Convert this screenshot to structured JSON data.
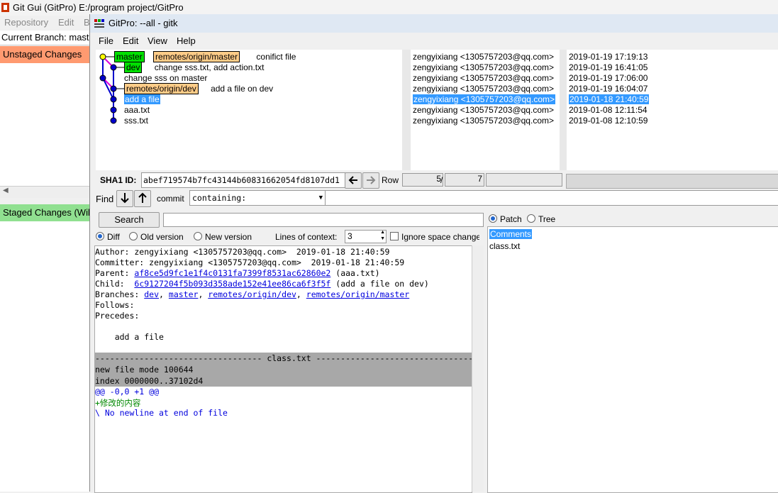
{
  "gitgui": {
    "title": "Git Gui (GitPro) E:/program project/GitPro",
    "menu": [
      "Repository",
      "Edit",
      "B"
    ],
    "current_branch": "Current Branch: master",
    "unstaged_header": "Unstaged Changes",
    "staged_header": "Staged Changes (Will Commit)"
  },
  "gitk": {
    "title": "GitPro: --all - gitk",
    "menu": [
      "File",
      "Edit",
      "View",
      "Help"
    ],
    "commits": [
      {
        "refs": [
          {
            "text": "master",
            "style": "green"
          },
          {
            "text": "remotes/origin/master",
            "style": "orange"
          }
        ],
        "msg": "conifict file",
        "author": "zengyixiang <1305757203@qq.com>",
        "date": "2019-01-19 17:19:13"
      },
      {
        "refs": [
          {
            "text": "dev",
            "style": "green"
          }
        ],
        "msg": "change sss.txt, add action.txt",
        "author": "zengyixiang <1305757203@qq.com>",
        "date": "2019-01-19 16:41:05"
      },
      {
        "refs": [],
        "msg": "change sss on master",
        "author": "zengyixiang <1305757203@qq.com>",
        "date": "2019-01-19 17:06:00"
      },
      {
        "refs": [
          {
            "text": "remotes/origin/dev",
            "style": "orange"
          }
        ],
        "msg": "add a file on dev",
        "author": "zengyixiang <1305757203@qq.com>",
        "date": "2019-01-19 16:04:07"
      },
      {
        "refs": [],
        "msg": "add a file",
        "author": "zengyixiang <1305757203@qq.com>",
        "date": "2019-01-18 21:40:59",
        "selected": true
      },
      {
        "refs": [],
        "msg": "aaa.txt",
        "author": "zengyixiang <1305757203@qq.com>",
        "date": "2019-01-08 12:11:54"
      },
      {
        "refs": [],
        "msg": "sss.txt",
        "author": "zengyixiang <1305757203@qq.com>",
        "date": "2019-01-08 12:10:59"
      }
    ],
    "sha_label": "SHA1 ID:",
    "sha_value": "abef719574b7fc43144b60831662054fd8107dd1",
    "row_label": "Row",
    "row_current": "5",
    "row_sep": "/",
    "row_total": "7",
    "find_label": "Find",
    "commit_label": "commit",
    "find_mode": "containing:",
    "search_button": "Search",
    "diff_options": {
      "diff": "Diff",
      "old": "Old version",
      "new": "New version",
      "selected": "Diff"
    },
    "lines_of_context_label": "Lines of context:",
    "lines_of_context_value": "3",
    "ignore_space_label": "Ignore space change",
    "patch_label": "Patch",
    "tree_label": "Tree",
    "view_selected": "Patch",
    "file_list": [
      "Comments",
      "class.txt"
    ],
    "diff": {
      "author": "Author: zengyixiang <1305757203@qq.com>  2019-01-18 21:40:59",
      "committer": "Committer: zengyixiang <1305757203@qq.com>  2019-01-18 21:40:59",
      "parent_label": "Parent: ",
      "parent_sha": "af8ce5d9fc1e1f4c0131fa7399f8531ac62860e2",
      "parent_desc": " (aaa.txt)",
      "child_label": "Child:  ",
      "child_sha": "6c9127204f5b093d358ade152e41ee86ca6f3f5f",
      "child_desc": " (add a file on dev)",
      "branches_label": "Branches: ",
      "branches": [
        "dev",
        "master",
        "remotes/origin/dev",
        "remotes/origin/master"
      ],
      "follows": "Follows:",
      "precedes": "Precedes:",
      "message": "    add a file",
      "file_header": "---------------------------------- class.txt ----------------------------------",
      "mode_line": "new file mode 100644",
      "index_line": "index 0000000..37102d4",
      "hunk_line": "@@ -0,0 +1 @@",
      "added_line": "+修改的内容",
      "nonewline": "\\ No newline at end of file"
    },
    "colors": {
      "selection": "#3399ff",
      "branch_green": "#00e000",
      "remote_orange": "#ffcc88",
      "graph_blue": "#0000cc",
      "graph_magenta": "#dd00dd",
      "head_yellow": "#ffff00",
      "added_green": "#008800",
      "hunk_blue": "#0000dd"
    }
  }
}
